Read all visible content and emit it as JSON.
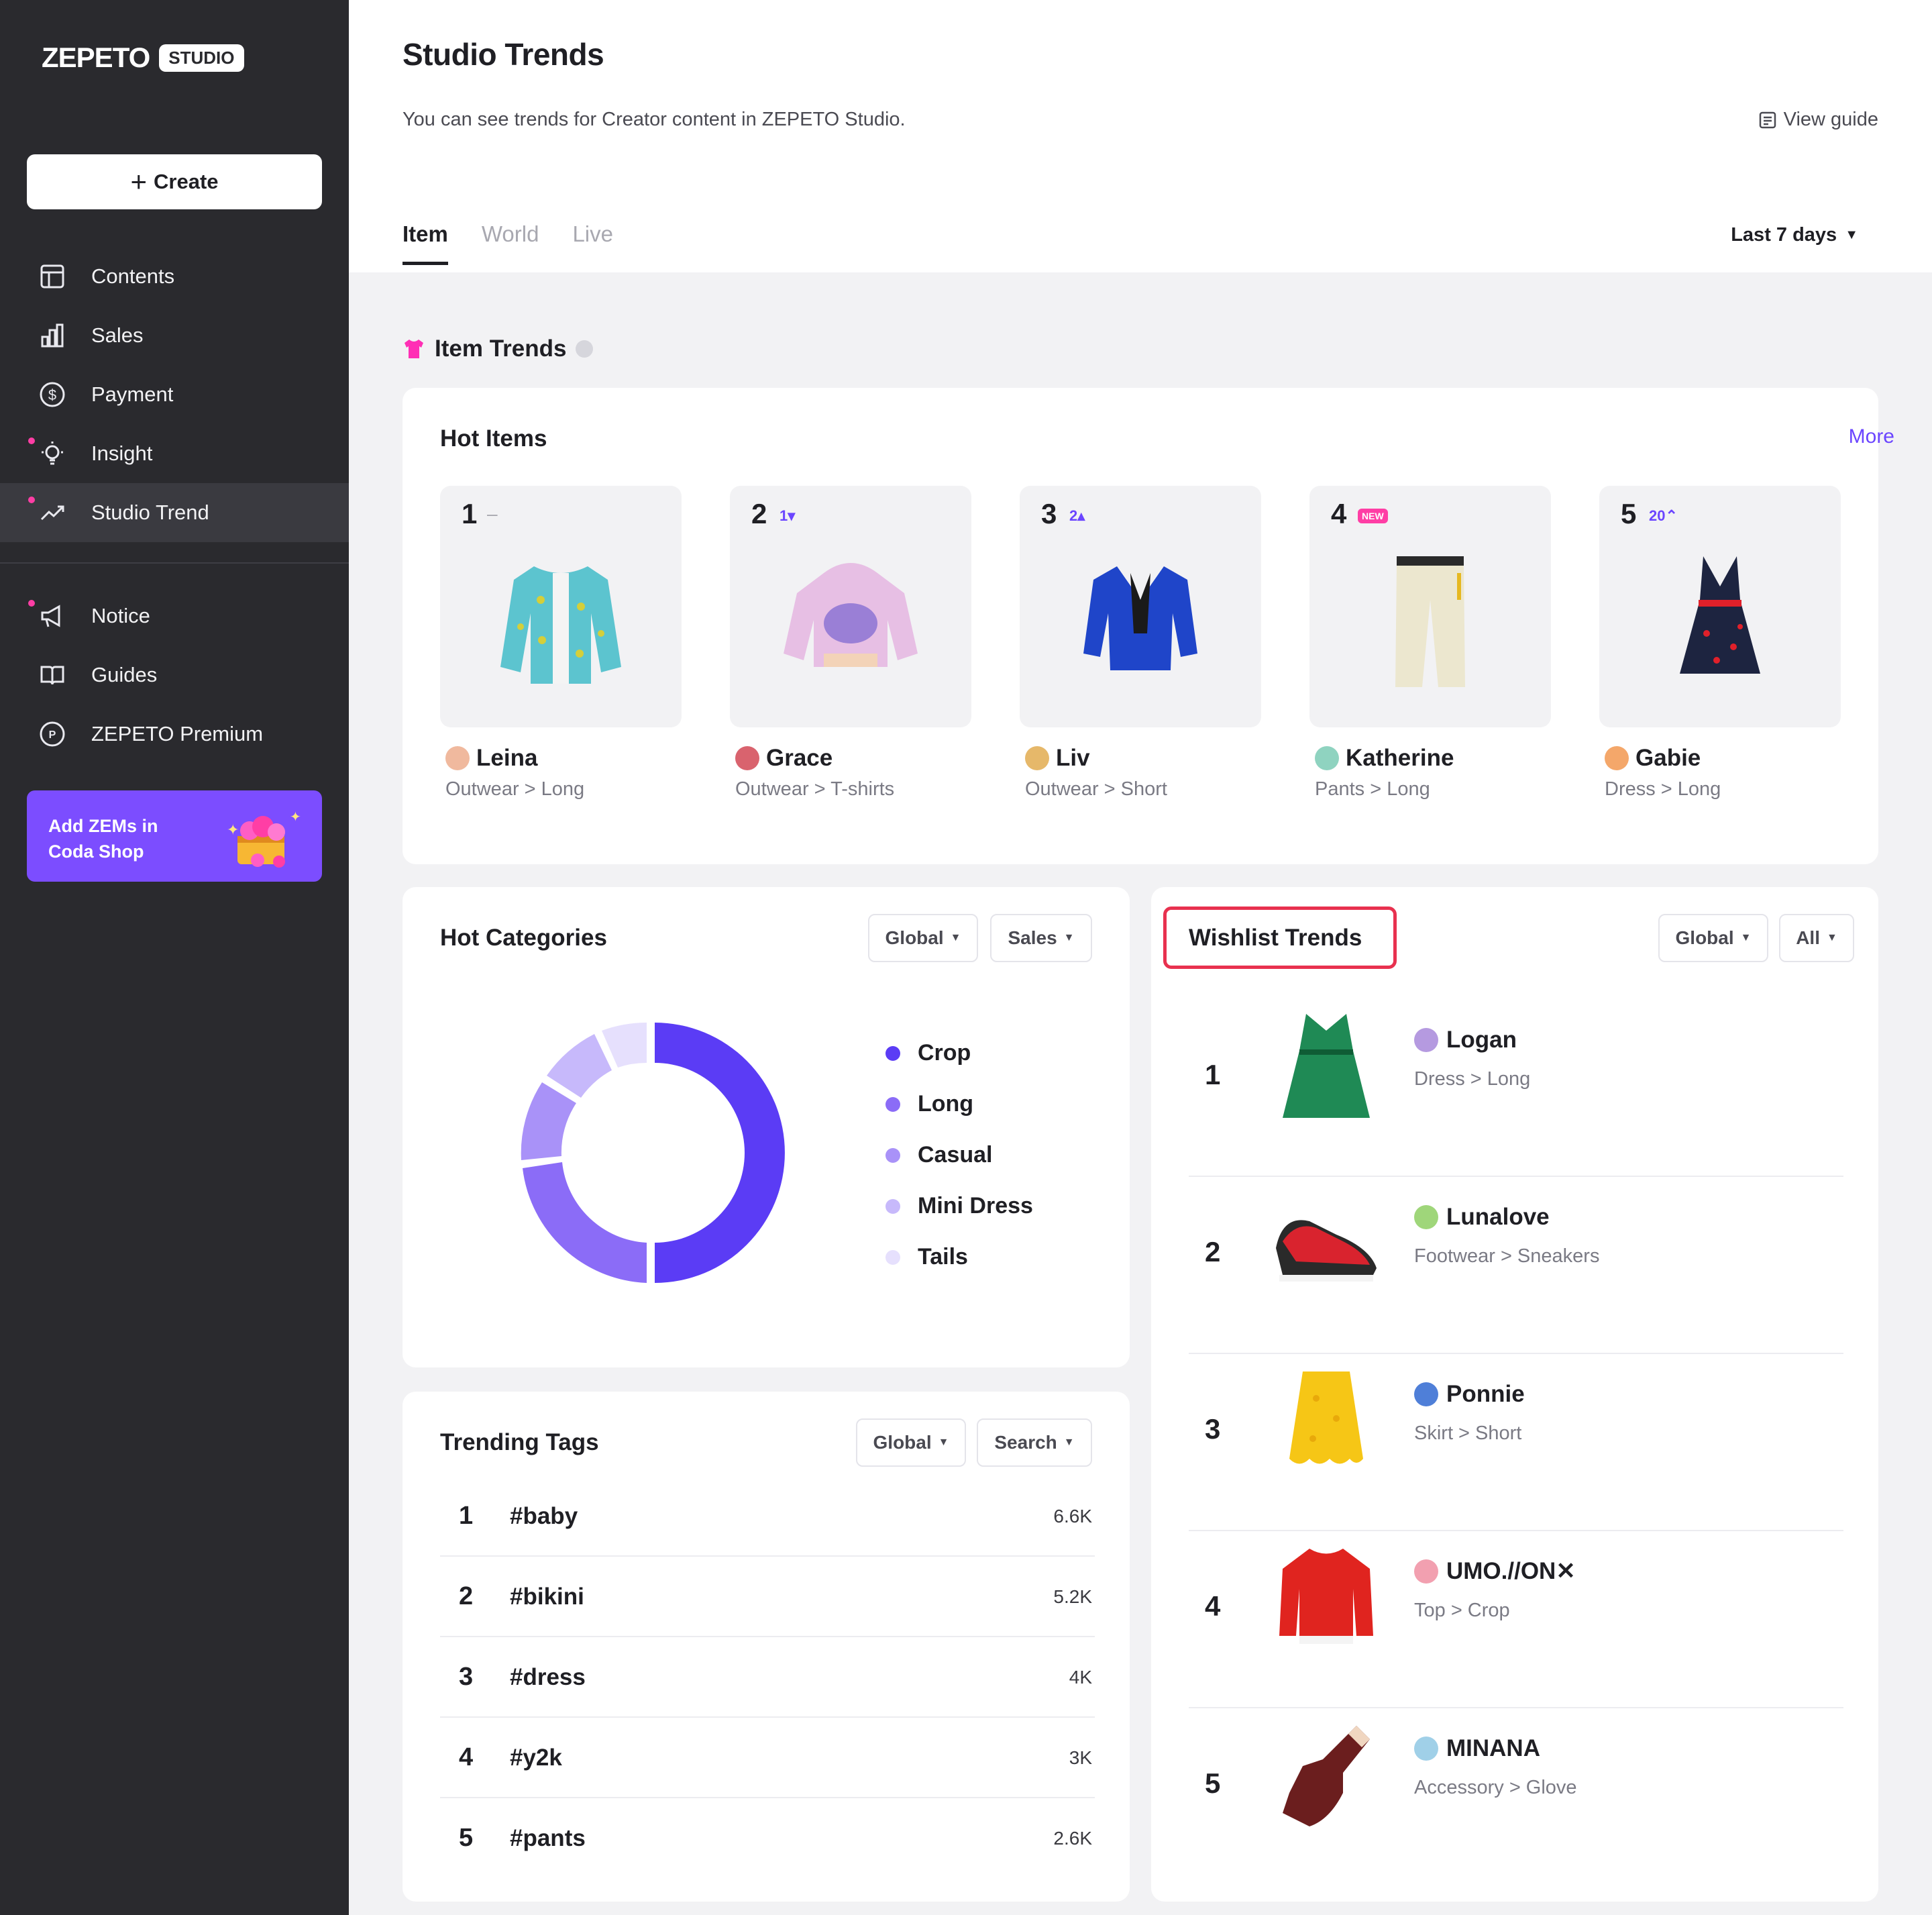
{
  "sidebar": {
    "logo": "ZEPETO",
    "logo_badge": "STUDIO",
    "create_label": "Create",
    "items": [
      {
        "label": "Contents",
        "icon": "layout-icon"
      },
      {
        "label": "Sales",
        "icon": "bar-chart-icon"
      },
      {
        "label": "Payment",
        "icon": "dollar-circle-icon"
      },
      {
        "label": "Insight",
        "icon": "lightbulb-icon"
      },
      {
        "label": "Studio Trend",
        "icon": "trend-up-icon"
      },
      {
        "label": "Notice",
        "icon": "megaphone-icon"
      },
      {
        "label": "Guides",
        "icon": "book-icon"
      },
      {
        "label": "ZEPETO Premium",
        "icon": "premium-icon"
      }
    ],
    "promo": "Add ZEMs in\nCoda Shop"
  },
  "header": {
    "title": "Studio Trends",
    "subtitle": "You can see trends for Creator content in ZEPETO Studio.",
    "view_guide": "View guide",
    "tabs": [
      "Item",
      "World",
      "Live"
    ],
    "period": "Last 7 days"
  },
  "item_trends": {
    "title": "Item Trends",
    "hot_items": {
      "title": "Hot Items",
      "more": "More",
      "items": [
        {
          "rank": "1",
          "delta": "–",
          "creator": "Leina",
          "category": "Outwear > Long"
        },
        {
          "rank": "2",
          "delta": "1▾",
          "creator": "Grace",
          "category": "Outwear > T-shirts"
        },
        {
          "rank": "3",
          "delta": "2▴",
          "creator": "Liv",
          "category": "Outwear > Short"
        },
        {
          "rank": "4",
          "delta": "NEW",
          "creator": "Katherine",
          "category": "Pants > Long"
        },
        {
          "rank": "5",
          "delta": "20⌃",
          "creator": "Gabie",
          "category": "Dress > Long"
        }
      ]
    }
  },
  "hot_categories": {
    "title": "Hot Categories",
    "region": "Global",
    "metric": "Sales",
    "legend": [
      "Crop",
      "Long",
      "Casual",
      "Mini Dress",
      "Tails"
    ],
    "colors": [
      "#5b3cf5",
      "#8b6cf7",
      "#a992f8",
      "#c7b9fb",
      "#e6e0fd"
    ]
  },
  "trending_tags": {
    "title": "Trending Tags",
    "region": "Global",
    "metric": "Search",
    "rows": [
      {
        "rank": "1",
        "tag": "#baby",
        "value": "6.6K"
      },
      {
        "rank": "2",
        "tag": "#bikini",
        "value": "5.2K"
      },
      {
        "rank": "3",
        "tag": "#dress",
        "value": "4K"
      },
      {
        "rank": "4",
        "tag": "#y2k",
        "value": "3K"
      },
      {
        "rank": "5",
        "tag": "#pants",
        "value": "2.6K"
      }
    ]
  },
  "wishlist_trends": {
    "title": "Wishlist Trends",
    "region": "Global",
    "filter": "All",
    "rows": [
      {
        "rank": "1",
        "creator": "Logan",
        "category": "Dress > Long"
      },
      {
        "rank": "2",
        "creator": "Lunalove",
        "category": "Footwear > Sneakers"
      },
      {
        "rank": "3",
        "creator": "Ponnie",
        "category": "Skirt > Short"
      },
      {
        "rank": "4",
        "creator": "UMO.//ON✕",
        "category": "Top > Crop"
      },
      {
        "rank": "5",
        "creator": "MINANA",
        "category": "Accessory > Glove"
      }
    ]
  }
}
